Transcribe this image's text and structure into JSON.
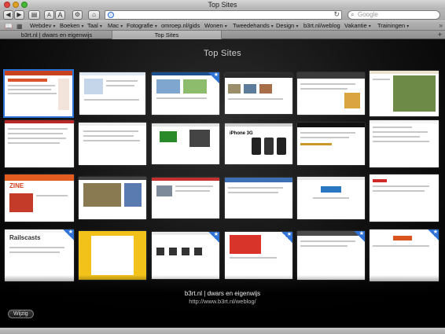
{
  "window": {
    "title": "Top Sites"
  },
  "toolbar": {
    "back_icon": "back-arrow-icon",
    "forward_icon": "forward-arrow-icon",
    "text_smaller_label": "A",
    "text_larger_label": "A",
    "address_value": "",
    "search_placeholder": "Google"
  },
  "bookmarks_bar": {
    "items": [
      {
        "label": "Webdev"
      },
      {
        "label": "Boeken"
      },
      {
        "label": "Taal"
      },
      {
        "label": "Mac"
      },
      {
        "label": "Fotografie"
      },
      {
        "label": "omroep.nl/gids"
      },
      {
        "label": "Wonen"
      },
      {
        "label": "Tweedehands"
      },
      {
        "label": "Design"
      },
      {
        "label": "b3rt.nl/weblog"
      },
      {
        "label": "Vakantie"
      },
      {
        "label": "Trainingen"
      }
    ],
    "more": "»"
  },
  "tabs": [
    {
      "label": "b3rt.nl | dwars en eigenwijs"
    },
    {
      "label": "Top Sites"
    }
  ],
  "top_sites": {
    "heading": "Top Sites",
    "selected_title": "b3rt.nl | dwars en eigenwijs",
    "selected_url": "http://www.b3rt.nl/weblog/",
    "edit_button": "Wijzig",
    "thumb_labels": {
      "sitezine": "ZINE",
      "railscasts": "Railscasts",
      "iphone": "iPhone 3G"
    }
  },
  "colors": {
    "accent": "#2a74d8",
    "background": "#000000"
  }
}
